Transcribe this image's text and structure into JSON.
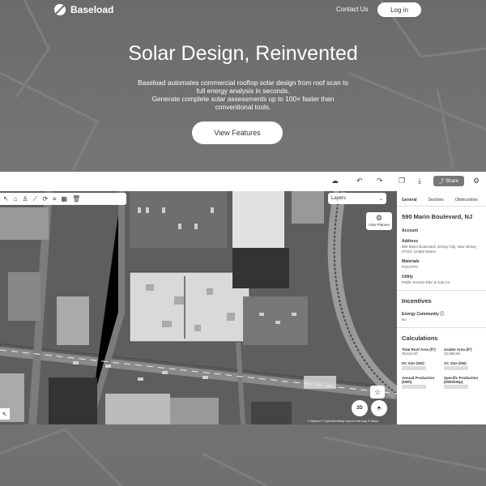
{
  "nav": {
    "brand": "Baseload",
    "contact_label": "Contact Us",
    "login_label": "Log in"
  },
  "hero": {
    "title": "Solar Design, Reinvented",
    "subtitle_line1": "Baseload automates commercial rooftop solar design from roof scan to",
    "subtitle_line2": "full energy analysis in seconds.",
    "subtitle_line3": "Generate complete solar assessments up to 100× faster than",
    "subtitle_line4": "conventional tools.",
    "cta_label": "View Features"
  },
  "app": {
    "share_label": "Share",
    "layers_label": "Layers",
    "view_button_label": "View Planner",
    "btn_3d": "3D",
    "attribution": "© Mapbox © OpenStreetMap  Improve this map  © Maxar",
    "panel": {
      "tabs": [
        "General",
        "Sections",
        "Obstructions"
      ],
      "address": "590 Marin Boulevard, NJ",
      "account_label": "Account",
      "address_label": "Address",
      "address_value": "590 Marin Boulevard, Jersey City, New Jersey 07310, United States",
      "materials_label": "Materials",
      "materials_value": "PVC/TPO",
      "utility_label": "Utility",
      "utility_value": "Public Service Elec & Gas Co",
      "incentives_title": "Incentives",
      "energy_community_label": "Energy Community",
      "energy_community_value": "No",
      "calculations_title": "Calculations",
      "total_roof_area_label": "Total Roof Area (ft²)",
      "total_roof_area_value": "35,514.87",
      "usable_area_label": "Usable Area (ft²)",
      "usable_area_value": "22,560.68",
      "dc_size_label": "DC Size (kW)",
      "ac_size_label": "AC Size (kW)",
      "annual_production_label": "Annual Production (kWh)",
      "specific_production_label": "Specific Production (kWh/kWp)"
    }
  },
  "colors": {
    "background": "#6f6f6f",
    "white": "#ffffff",
    "panel_text": "#333333"
  }
}
